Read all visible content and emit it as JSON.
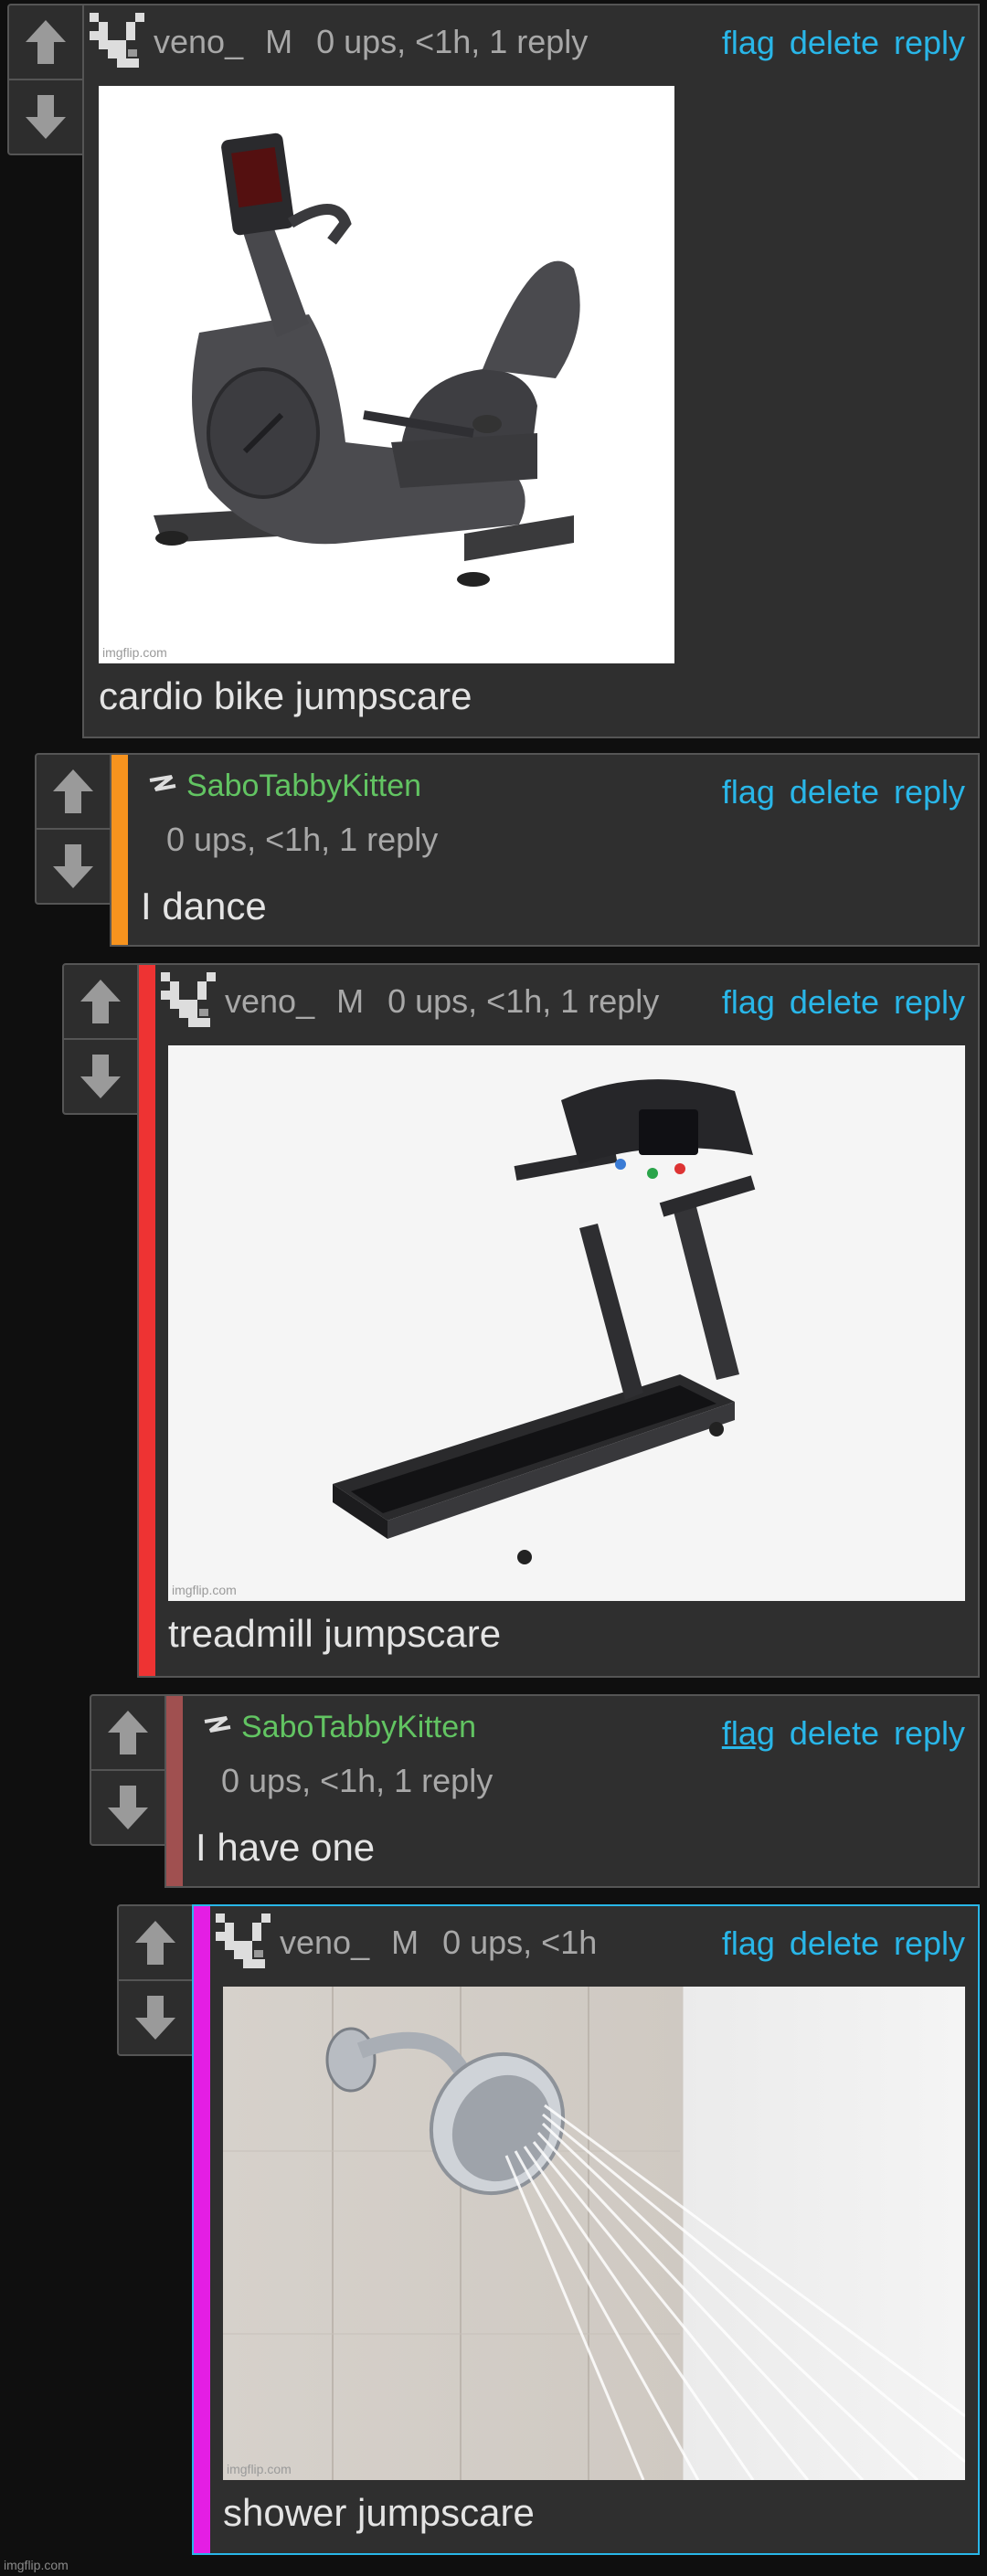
{
  "vote": {
    "up_icon": "arrow-up-icon",
    "down_icon": "arrow-down-icon"
  },
  "actions": {
    "flag": "flag",
    "delete": "delete",
    "reply": "reply"
  },
  "comments": [
    {
      "username": "veno_",
      "tag": "M",
      "meta": "0 ups, <1h, 1 reply",
      "text": "cardio bike jumpscare",
      "image_watermark": "imgflip.com",
      "bar_color": ""
    },
    {
      "username": "SaboTabbyKitten",
      "meta": "0 ups, <1h, 1 reply",
      "text": "I dance",
      "bar_color": "#f7931e"
    },
    {
      "username": "veno_",
      "tag": "M",
      "meta": "0 ups, <1h, 1 reply",
      "text": "treadmill jumpscare",
      "image_watermark": "imgflip.com",
      "bar_color": "#ee3333"
    },
    {
      "username": "SaboTabbyKitten",
      "meta": "0 ups, <1h, 1 reply",
      "text": "I have one",
      "bar_color": "#a05050"
    },
    {
      "username": "veno_",
      "tag": "M",
      "meta": "0 ups, <1h",
      "text": "shower jumpscare",
      "image_watermark": "imgflip.com",
      "bar_color": "#e41ee4",
      "border_color": "#29b6e8"
    }
  ],
  "footer_watermark": "imgflip.com"
}
